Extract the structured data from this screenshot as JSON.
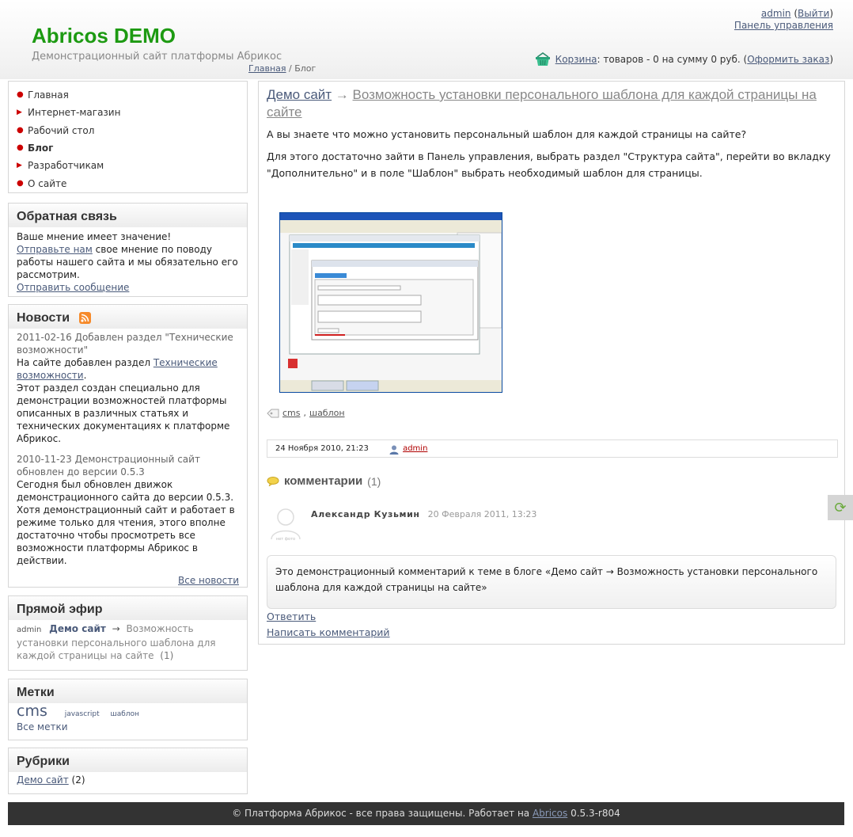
{
  "site": {
    "logo": "Abricos DEMO",
    "slogan": "Демонстрационный сайт платформы Абрикос"
  },
  "breadcrumb": {
    "home": "Главная",
    "sep": " / ",
    "current": "Блог"
  },
  "user": {
    "name": "admin",
    "logout": "Выйти",
    "panel": "Панель управления"
  },
  "cart": {
    "link": "Корзина",
    "summary": ": товаров - 0 на сумму 0 руб. (",
    "order": "Оформить заказ",
    "close": ")"
  },
  "menu": [
    {
      "label": "Главная"
    },
    {
      "label": "Интернет-магазин"
    },
    {
      "label": "Рабочий стол"
    },
    {
      "label": "Блог"
    },
    {
      "label": "Разработчикам"
    },
    {
      "label": "О сайте"
    }
  ],
  "feedback": {
    "title": "Обратная связь",
    "line1": "Ваше мнение имеет значение!",
    "link": "Отправьте нам",
    "text": " свое мнение по поводу работы нашего сайта и мы обязательно его рассмотрим.",
    "send": "Отправить сообщение"
  },
  "news": {
    "title": "Новости",
    "items": [
      {
        "date": "2011-02-16",
        "title": " Добавлен раздел \"Технические возможности\"",
        "pre": "На сайте добавлен раздел ",
        "link": "Технические возможности",
        "post": ".",
        "text": "Этот раздел создан специально для демонстрации возможностей платформы описанных в различных статьях и технических документациях к платформе Абрикос."
      },
      {
        "date": "2010-11-23",
        "title": " Демонстрационный сайт обновлен до версии 0.5.3",
        "text": "Сегодня был обновлен движок демонстрационного сайта до версии 0.5.3. Хотя демонстрационный сайт и работает в режиме только для чтения, этого вполне достаточно чтобы просмотреть все возможности платформы Абрикос в действии."
      }
    ],
    "all": "Все новости"
  },
  "live": {
    "title": "Прямой эфир",
    "user": "admin",
    "blog": "Демо сайт",
    "arrow": "→",
    "post": "Возможность установки персонального шаблона для каждой страницы на сайте",
    "count": "(1)"
  },
  "tags": {
    "title": "Метки",
    "items": [
      "cms",
      "javascript",
      "шаблон"
    ],
    "all": "Все метки"
  },
  "rubrics": {
    "title": "Рубрики",
    "link": "Демо сайт",
    "count": " (2)"
  },
  "post": {
    "blog": "Демо сайт",
    "arrow": " → ",
    "title": "Возможность установки персонального шаблона для каждой страницы на сайте",
    "p1": "А вы знаете что можно установить персональный шаблон для каждой страницы на сайте?",
    "p2": "Для этого достаточно зайти в Панель управления, выбрать раздел \"Структура сайта\", перейти во вкладку \"Дополнительно\" и в поле \"Шаблон\" выбрать необходимый шаблон для страницы.",
    "tag1": "cms",
    "tag2": "шаблон",
    "date": "24 Ноября 2010, 21:23",
    "author": "admin"
  },
  "comments": {
    "title": "комментарии",
    "count": "(1)",
    "author": "Александр Кузьмин",
    "date": "20 Февраля 2011, 13:23",
    "avatar_caption": "нет фото",
    "text": "Это демонстрационный комментарий к теме в блоге «Демо сайт → Возможность установки персонального шаблона для каждой страницы на сайте»",
    "reply": "Ответить",
    "write": "Написать комментарий"
  },
  "footer": {
    "text": "© Платформа Абрикос - все права защищены. Работает на ",
    "link": "Abricos",
    "version": " 0.5.3-r804"
  },
  "colors": {
    "logo": "#1d9a12",
    "link": "#4a5a7a",
    "bullet": "#cc0000",
    "footer_bg": "#333333"
  }
}
